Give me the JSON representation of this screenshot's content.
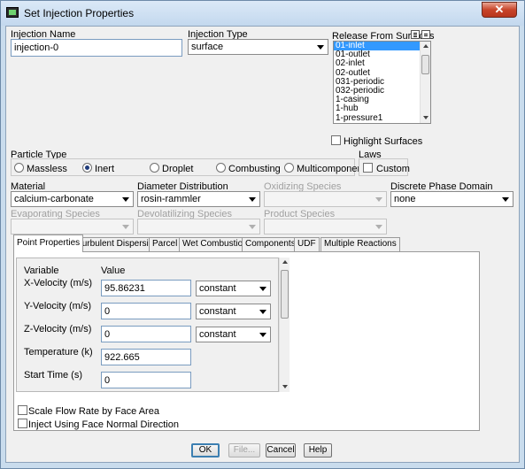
{
  "window": {
    "title": "Set Injection Properties",
    "close_glyph": "✕"
  },
  "injection_name": {
    "label": "Injection Name",
    "value": "injection-0"
  },
  "injection_type": {
    "label": "Injection Type",
    "value": "surface"
  },
  "release_from_surfaces": {
    "label": "Release From Surfaces",
    "items": [
      "01-inlet",
      "01-outlet",
      "02-inlet",
      "02-outlet",
      "031-periodic",
      "032-periodic",
      "1-casing",
      "1-hub",
      "1-pressure1"
    ],
    "selected_index": 0,
    "select_all_icon": "select-all-icon",
    "deselect_all_icon": "deselect-all-icon"
  },
  "highlight_surfaces": {
    "label": "Highlight Surfaces",
    "checked": false
  },
  "particle_type": {
    "label": "Particle Type",
    "options": [
      "Massless",
      "Inert",
      "Droplet",
      "Combusting",
      "Multicomponent"
    ],
    "selected": "Inert"
  },
  "laws": {
    "label": "Laws",
    "custom_label": "Custom",
    "checked": false
  },
  "material": {
    "label": "Material",
    "value": "calcium-carbonate"
  },
  "diameter_distribution": {
    "label": "Diameter Distribution",
    "value": "rosin-rammler"
  },
  "oxidizing_species": {
    "label": "Oxidizing Species",
    "value": ""
  },
  "discrete_phase_domain": {
    "label": "Discrete Phase Domain",
    "value": "none"
  },
  "evaporating_species": {
    "label": "Evaporating Species",
    "value": ""
  },
  "devolatilizing_species": {
    "label": "Devolatilizing Species",
    "value": ""
  },
  "product_species": {
    "label": "Product Species",
    "value": ""
  },
  "tabs": [
    "Point Properties",
    "Turbulent Dispersion",
    "Parcel",
    "Wet Combustion",
    "Components",
    "UDF",
    "Multiple Reactions"
  ],
  "active_tab": "Point Properties",
  "point_properties": {
    "variable_header": "Variable",
    "value_header": "Value",
    "rows": [
      {
        "label": "X-Velocity (m/s)",
        "value": "95.86231",
        "method": "constant"
      },
      {
        "label": "Y-Velocity (m/s)",
        "value": "0",
        "method": "constant"
      },
      {
        "label": "Z-Velocity (m/s)",
        "value": "0",
        "method": "constant"
      },
      {
        "label": "Temperature (k)",
        "value": "922.665",
        "method": ""
      },
      {
        "label": "Start Time (s)",
        "value": "0",
        "method": ""
      }
    ]
  },
  "scale_flow_rate": {
    "label": "Scale Flow Rate by Face Area",
    "checked": false
  },
  "inject_face_normal": {
    "label": "Inject Using Face Normal Direction",
    "checked": false
  },
  "buttons": {
    "ok": "OK",
    "file": "File...",
    "cancel": "Cancel",
    "help": "Help"
  }
}
